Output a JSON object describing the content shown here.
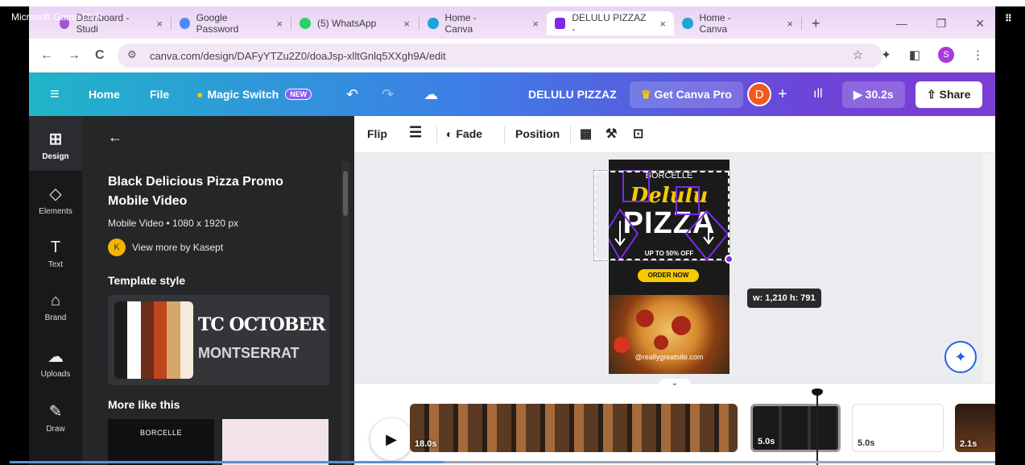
{
  "overlay": {
    "title": "Microsoft Game DVR"
  },
  "browser": {
    "tabs": [
      {
        "label": "Dashboard - Studi",
        "color": "#9b59d0"
      },
      {
        "label": "Google Password",
        "color": "#4c8bf5"
      },
      {
        "label": "(5) WhatsApp",
        "color": "#25d366"
      },
      {
        "label": "Home - Canva",
        "color": "#1fa3d6"
      },
      {
        "label": "DELULU PIZZAZ -",
        "color": "#7d2ae8"
      },
      {
        "label": "Home - Canva",
        "color": "#1fa3d6"
      }
    ],
    "new_tab": "+",
    "tab_close": "×",
    "url": "canva.com/design/DAFyYTZu2Z0/doaJsp-xlltGnlq5XXgh9A/edit",
    "profile_initial": "S"
  },
  "header": {
    "menu_icon": "≡",
    "home": "Home",
    "file": "File",
    "magic_switch": "Magic Switch",
    "new_badge": "NEW",
    "doc_title": "DELULU PIZZAZ",
    "get_pro": "Get Canva Pro",
    "avatar": "D",
    "add": "+",
    "duration": "30.2s",
    "share": "Share"
  },
  "rail": {
    "items": [
      {
        "label": "Design",
        "icon": "⊞"
      },
      {
        "label": "Elements",
        "icon": "◇"
      },
      {
        "label": "Text",
        "icon": "T"
      },
      {
        "label": "Brand",
        "icon": "⌂"
      },
      {
        "label": "Uploads",
        "icon": "☁"
      },
      {
        "label": "Draw",
        "icon": "✎"
      }
    ]
  },
  "panel": {
    "back": "←",
    "title": "Black Delicious Pizza Promo Mobile Video",
    "subtitle": "Mobile Video • 1080 x 1920 px",
    "author_initial": "K",
    "author": "View more by Kasept",
    "template_style": "Template style",
    "font1": "TC OCTOBER",
    "font2": "MONTSERRAT",
    "more": "More like this",
    "thumb_text": "BORCELLE",
    "swatches": [
      "#1b1b1b",
      "#ffffff",
      "#6b2c1a",
      "#c1451d",
      "#d8a66a",
      "#f4ebdc"
    ]
  },
  "toolbar": {
    "flip": "Flip",
    "fade": "Fade",
    "position": "Position"
  },
  "design": {
    "brand": "BORCELLE",
    "script": "Delulu",
    "headline": "PIZZA",
    "offer": "UP TO 50% OFF",
    "cta": "ORDER NOW",
    "site": "@reallygreatsite.com"
  },
  "tooltip": "w: 1,210 h: 791",
  "timeline": {
    "clips": [
      {
        "duration": "18.0s"
      },
      {
        "duration": "5.0s"
      },
      {
        "duration": "5.0s"
      },
      {
        "duration": "2.1s"
      }
    ]
  }
}
